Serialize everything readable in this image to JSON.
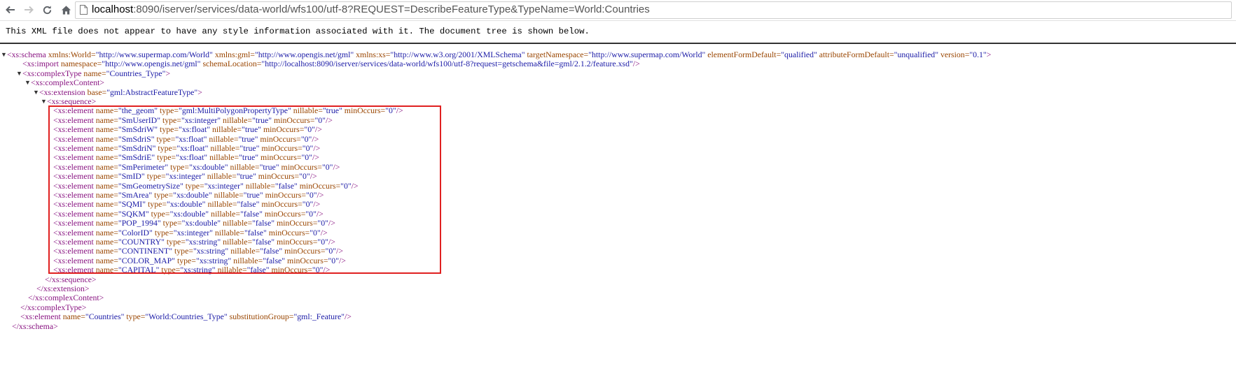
{
  "browser": {
    "url_host": "localhost",
    "url_rest": ":8090/iserver/services/data-world/wfs100/utf-8?REQUEST=DescribeFeatureType&TypeName=World:Countries"
  },
  "notice": "This XML file does not appear to have any style information associated with it. The document tree is shown below.",
  "schema_open": {
    "tag": "<xs:schema",
    "attrs": [
      {
        "n": " xmlns:World=",
        "v": "\"http://www.supermap.com/World\""
      },
      {
        "n": " xmlns:gml=",
        "v": "\"http://www.opengis.net/gml\""
      },
      {
        "n": " xmlns:xs=",
        "v": "\"http://www.w3.org/2001/XMLSchema\""
      },
      {
        "n": " targetNamespace=",
        "v": "\"http://www.supermap.com/World\""
      },
      {
        "n": " elementFormDefault=",
        "v": "\"qualified\""
      },
      {
        "n": " attributeFormDefault=",
        "v": "\"unqualified\""
      },
      {
        "n": " version=",
        "v": "\"0.1\""
      }
    ],
    "end": ">"
  },
  "import_line": {
    "tag": "<xs:import",
    "attrs": [
      {
        "n": " namespace=",
        "v": "\"http://www.opengis.net/gml\""
      },
      {
        "n": " schemaLocation=",
        "v": "\"http://localhost:8090/iserver/services/data-world/wfs100/utf-8?request=getschema&file=gml/2.1.2/feature.xsd\""
      }
    ],
    "end": "/>"
  },
  "complex_open": {
    "tag": "<xs:complexType",
    "attrs": [
      {
        "n": " name=",
        "v": "\"Countries_Type\""
      }
    ],
    "end": ">"
  },
  "content_open": "<xs:complexContent>",
  "extension_open": {
    "tag": "<xs:extension",
    "attrs": [
      {
        "n": " base=",
        "v": "\"gml:AbstractFeatureType\""
      }
    ],
    "end": ">"
  },
  "sequence_open": "<xs:sequence>",
  "elements": [
    {
      "name": "\"the_geom\"",
      "type": "\"gml:MultiPolygonPropertyType\"",
      "nillable": "\"true\"",
      "minOccurs": "\"0\""
    },
    {
      "name": "\"SmUserID\"",
      "type": "\"xs:integer\"",
      "nillable": "\"true\"",
      "minOccurs": "\"0\""
    },
    {
      "name": "\"SmSdriW\"",
      "type": "\"xs:float\"",
      "nillable": "\"true\"",
      "minOccurs": "\"0\""
    },
    {
      "name": "\"SmSdriS\"",
      "type": "\"xs:float\"",
      "nillable": "\"true\"",
      "minOccurs": "\"0\""
    },
    {
      "name": "\"SmSdriN\"",
      "type": "\"xs:float\"",
      "nillable": "\"true\"",
      "minOccurs": "\"0\""
    },
    {
      "name": "\"SmSdriE\"",
      "type": "\"xs:float\"",
      "nillable": "\"true\"",
      "minOccurs": "\"0\""
    },
    {
      "name": "\"SmPerimeter\"",
      "type": "\"xs:double\"",
      "nillable": "\"true\"",
      "minOccurs": "\"0\""
    },
    {
      "name": "\"SmID\"",
      "type": "\"xs:integer\"",
      "nillable": "\"true\"",
      "minOccurs": "\"0\""
    },
    {
      "name": "\"SmGeometrySize\"",
      "type": "\"xs:integer\"",
      "nillable": "\"false\"",
      "minOccurs": "\"0\""
    },
    {
      "name": "\"SmArea\"",
      "type": "\"xs:double\"",
      "nillable": "\"true\"",
      "minOccurs": "\"0\""
    },
    {
      "name": "\"SQMI\"",
      "type": "\"xs:double\"",
      "nillable": "\"false\"",
      "minOccurs": "\"0\""
    },
    {
      "name": "\"SQKM\"",
      "type": "\"xs:double\"",
      "nillable": "\"false\"",
      "minOccurs": "\"0\""
    },
    {
      "name": "\"POP_1994\"",
      "type": "\"xs:double\"",
      "nillable": "\"false\"",
      "minOccurs": "\"0\""
    },
    {
      "name": "\"ColorID\"",
      "type": "\"xs:integer\"",
      "nillable": "\"false\"",
      "minOccurs": "\"0\""
    },
    {
      "name": "\"COUNTRY\"",
      "type": "\"xs:string\"",
      "nillable": "\"false\"",
      "minOccurs": "\"0\""
    },
    {
      "name": "\"CONTINENT\"",
      "type": "\"xs:string\"",
      "nillable": "\"false\"",
      "minOccurs": "\"0\""
    },
    {
      "name": "\"COLOR_MAP\"",
      "type": "\"xs:string\"",
      "nillable": "\"false\"",
      "minOccurs": "\"0\""
    },
    {
      "name": "\"CAPITAL\"",
      "type": "\"xs:string\"",
      "nillable": "\"false\"",
      "minOccurs": "\"0\""
    }
  ],
  "element_tag": "<xs:element",
  "attr_labels": {
    "name": " name=",
    "type": " type=",
    "nillable": " nillable=",
    "minOccurs": " minOccurs="
  },
  "self_close": "/>",
  "sequence_close": "</xs:sequence>",
  "extension_close": "</xs:extension>",
  "content_close": "</xs:complexContent>",
  "complex_close": "</xs:complexType>",
  "countries_element": {
    "tag": "<xs:element",
    "attrs": [
      {
        "n": " name=",
        "v": "\"Countries\""
      },
      {
        "n": " type=",
        "v": "\"World:Countries_Type\""
      },
      {
        "n": " substitutionGroup=",
        "v": "\"gml:_Feature\""
      }
    ],
    "end": "/>"
  },
  "schema_close": "</xs:schema>",
  "colors": {
    "tag": "#881280",
    "attr_name": "#994500",
    "attr_value": "#1a1aa6",
    "highlight": "#e02020"
  }
}
